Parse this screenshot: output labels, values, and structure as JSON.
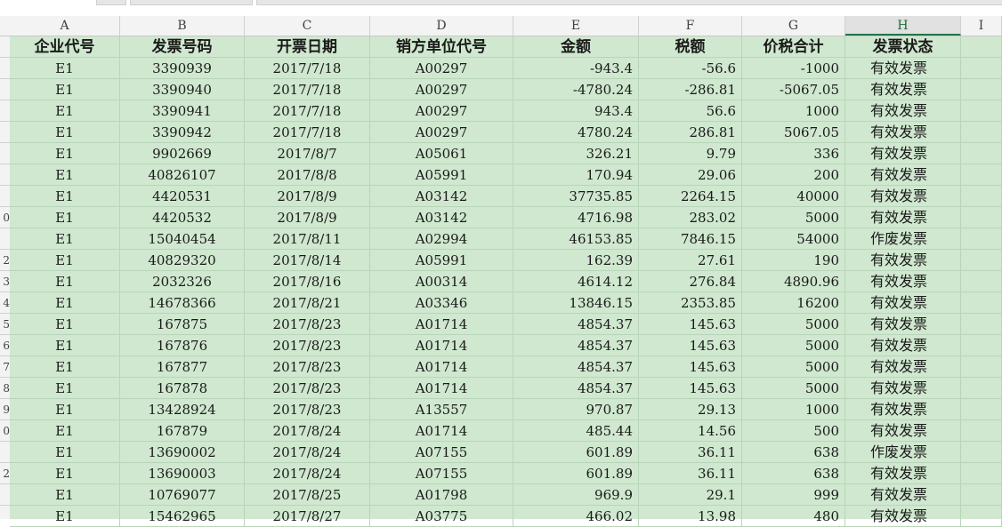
{
  "columns": [
    "A",
    "B",
    "C",
    "D",
    "E",
    "F",
    "G",
    "H",
    "I"
  ],
  "row_numbers": [
    "",
    "",
    "",
    "",
    "",
    "",
    "",
    "",
    "0",
    "",
    "2",
    "3",
    "4",
    "5",
    "6",
    "7",
    "8",
    "9",
    "0",
    "",
    "2",
    ""
  ],
  "headers": [
    "企业代号",
    "发票号码",
    "开票日期",
    "销方单位代号",
    "金额",
    "税额",
    "价税合计",
    "发票状态"
  ],
  "rows": [
    [
      "E1",
      "3390939",
      "2017/7/18",
      "A00297",
      "-943.4",
      "-56.6",
      "-1000",
      "有效发票"
    ],
    [
      "E1",
      "3390940",
      "2017/7/18",
      "A00297",
      "-4780.24",
      "-286.81",
      "-5067.05",
      "有效发票"
    ],
    [
      "E1",
      "3390941",
      "2017/7/18",
      "A00297",
      "943.4",
      "56.6",
      "1000",
      "有效发票"
    ],
    [
      "E1",
      "3390942",
      "2017/7/18",
      "A00297",
      "4780.24",
      "286.81",
      "5067.05",
      "有效发票"
    ],
    [
      "E1",
      "9902669",
      "2017/8/7",
      "A05061",
      "326.21",
      "9.79",
      "336",
      "有效发票"
    ],
    [
      "E1",
      "40826107",
      "2017/8/8",
      "A05991",
      "170.94",
      "29.06",
      "200",
      "有效发票"
    ],
    [
      "E1",
      "4420531",
      "2017/8/9",
      "A03142",
      "37735.85",
      "2264.15",
      "40000",
      "有效发票"
    ],
    [
      "E1",
      "4420532",
      "2017/8/9",
      "A03142",
      "4716.98",
      "283.02",
      "5000",
      "有效发票"
    ],
    [
      "E1",
      "15040454",
      "2017/8/11",
      "A02994",
      "46153.85",
      "7846.15",
      "54000",
      "作废发票"
    ],
    [
      "E1",
      "40829320",
      "2017/8/14",
      "A05991",
      "162.39",
      "27.61",
      "190",
      "有效发票"
    ],
    [
      "E1",
      "2032326",
      "2017/8/16",
      "A00314",
      "4614.12",
      "276.84",
      "4890.96",
      "有效发票"
    ],
    [
      "E1",
      "14678366",
      "2017/8/21",
      "A03346",
      "13846.15",
      "2353.85",
      "16200",
      "有效发票"
    ],
    [
      "E1",
      "167875",
      "2017/8/23",
      "A01714",
      "4854.37",
      "145.63",
      "5000",
      "有效发票"
    ],
    [
      "E1",
      "167876",
      "2017/8/23",
      "A01714",
      "4854.37",
      "145.63",
      "5000",
      "有效发票"
    ],
    [
      "E1",
      "167877",
      "2017/8/23",
      "A01714",
      "4854.37",
      "145.63",
      "5000",
      "有效发票"
    ],
    [
      "E1",
      "167878",
      "2017/8/23",
      "A01714",
      "4854.37",
      "145.63",
      "5000",
      "有效发票"
    ],
    [
      "E1",
      "13428924",
      "2017/8/23",
      "A13557",
      "970.87",
      "29.13",
      "1000",
      "有效发票"
    ],
    [
      "E1",
      "167879",
      "2017/8/24",
      "A01714",
      "485.44",
      "14.56",
      "500",
      "有效发票"
    ],
    [
      "E1",
      "13690002",
      "2017/8/24",
      "A07155",
      "601.89",
      "36.11",
      "638",
      "作废发票"
    ],
    [
      "E1",
      "13690003",
      "2017/8/24",
      "A07155",
      "601.89",
      "36.11",
      "638",
      "有效发票"
    ],
    [
      "E1",
      "10769077",
      "2017/8/25",
      "A01798",
      "969.9",
      "29.1",
      "999",
      "有效发票"
    ],
    [
      "E1",
      "15462965",
      "2017/8/27",
      "A03775",
      "466.02",
      "13.98",
      "480",
      "有效发票"
    ]
  ],
  "selected_column": "H",
  "colors": {
    "grid_bg": "#cfe8cf",
    "gridline": "#b9d5b9",
    "header_bg": "#f3f3f3",
    "accent": "#217346"
  }
}
